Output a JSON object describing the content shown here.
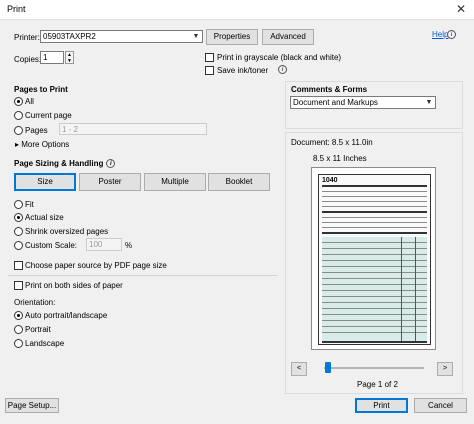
{
  "window": {
    "title": "Print",
    "close_glyph": "✕"
  },
  "printer": {
    "label": "Printer:",
    "value": "05903TAXPR2",
    "properties_label": "Properties",
    "advanced_label": "Advanced",
    "help_label": "Help"
  },
  "copies": {
    "label": "Copies:",
    "value": "1"
  },
  "options": {
    "grayscale_label": "Print in grayscale (black and white)",
    "save_ink_label": "Save ink/toner"
  },
  "pages_to_print": {
    "heading": "Pages to Print",
    "all_label": "All",
    "current_label": "Current page",
    "pages_label": "Pages",
    "pages_value": "1 - 2",
    "more_options_label": "More Options",
    "selected": "All"
  },
  "sizing": {
    "heading": "Page Sizing & Handling",
    "buttons": [
      "Size",
      "Poster",
      "Multiple",
      "Booklet"
    ],
    "selected_button": "Size",
    "fit_label": "Fit",
    "actual_label": "Actual size",
    "shrink_label": "Shrink oversized pages",
    "custom_label": "Custom Scale:",
    "custom_value": "100",
    "percent": "%",
    "selected": "Actual size",
    "paper_source_label": "Choose paper source by PDF page size"
  },
  "duplex": {
    "label": "Print on both sides of paper"
  },
  "orientation": {
    "heading": "Orientation:",
    "auto_label": "Auto portrait/landscape",
    "portrait_label": "Portrait",
    "landscape_label": "Landscape",
    "selected": "Auto portrait/landscape"
  },
  "comments": {
    "heading": "Comments & Forms",
    "value": "Document and Markups"
  },
  "preview": {
    "document_label": "Document: 8.5 x 11.0in",
    "paper_label": "8.5 x 11 Inches",
    "page_indicator": "Page 1 of 2",
    "prev_glyph": "<",
    "next_glyph": ">",
    "form_number": "1040"
  },
  "footer": {
    "page_setup_label": "Page Setup...",
    "print_label": "Print",
    "cancel_label": "Cancel"
  },
  "colors": {
    "accent": "#0078d7",
    "link": "#0a5bd3"
  }
}
